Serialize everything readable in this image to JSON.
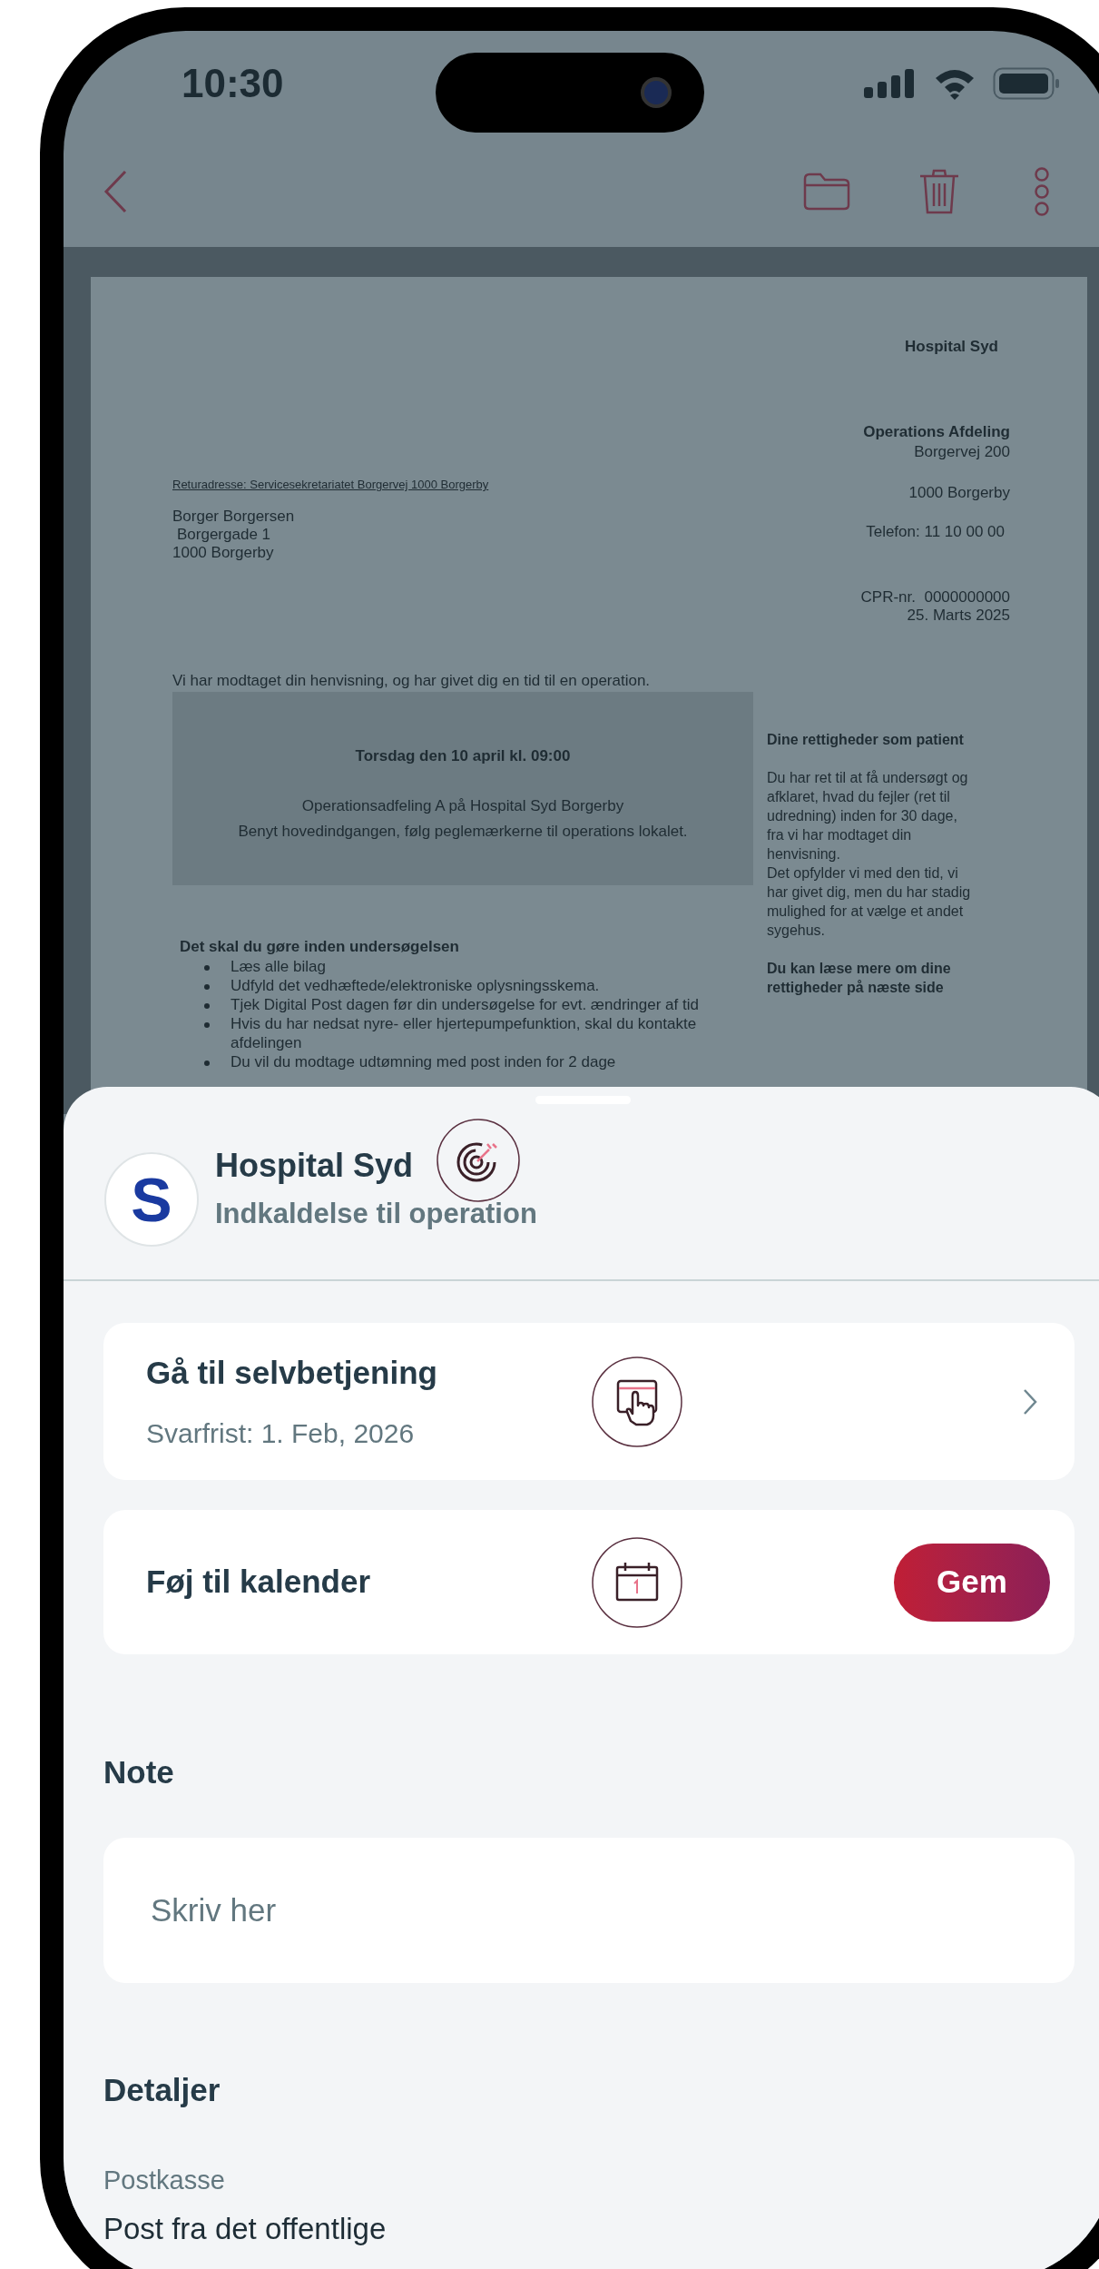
{
  "status_bar": {
    "time": "10:30"
  },
  "document": {
    "sender_name": "Hospital Syd",
    "department": "Operations Afdeling",
    "department_address": "Borgervej 200",
    "department_city": "1000 Borgerby",
    "phone": "Telefon: 11 10 00 00",
    "cpr": "CPR-nr.  0000000000",
    "date": "25. Marts 2025",
    "return_address": "Returadresse: Servicesekretariatet Borgervej  1000 Borgerby",
    "recipient": [
      "Borger Borgersen",
      "Borgergade 1",
      "1000 Borgerby"
    ],
    "intro": "Vi har modtaget din henvisning, og har givet dig en tid til en operation.",
    "appointment": {
      "time": "Torsdag den 10 april kl. 09:00",
      "lines": [
        "Operationsadfeling A på Hospital Syd Borgerby",
        "Benyt hovedindgangen, følg peglemærkerne til operations lokalet."
      ]
    },
    "todo_heading": "Det skal du gøre inden undersøgelsen",
    "todo_items": [
      "Læs alle bilag",
      "Udfyld det vedhæftede/elektroniske oplysningsskema.",
      "Tjek Digital Post dagen før din undersøgelse for evt. ændringer af tid",
      "Hvis du har nedsat nyre- eller hjertepumpefunktion, skal du kontakte afdelingen",
      "Du vil du modtage udtømning med post inden for 2 dage"
    ],
    "rights_heading": "Dine rettigheder som patient",
    "rights_body": [
      "Du har ret til at få undersøgt og afklaret, hvad du fejler (ret til udredning) inden for 30 dage, fra vi har modtaget din henvisning.",
      "Det opfylder vi med den tid, vi har givet dig, men du har stadig mulighed for at vælge et andet sygehus."
    ],
    "rights_more": "Du kan læse mere om dine rettigheder på næste side"
  },
  "sheet": {
    "avatar_letter": "S",
    "sender": "Hospital Syd",
    "subject": "Indkaldelse til operation",
    "actions": [
      {
        "kind": "link",
        "title": "Gå til selvbetjening",
        "subtitle": "Svarfrist: 1. Feb, 2026"
      },
      {
        "kind": "button",
        "title": "Føj til kalender",
        "button": "Gem"
      }
    ],
    "note": {
      "heading": "Note",
      "placeholder": "Skriv her"
    },
    "details": {
      "heading": "Detaljer",
      "items": [
        {
          "label": "Postkasse",
          "value": "Post fra det offentlige"
        }
      ]
    }
  }
}
